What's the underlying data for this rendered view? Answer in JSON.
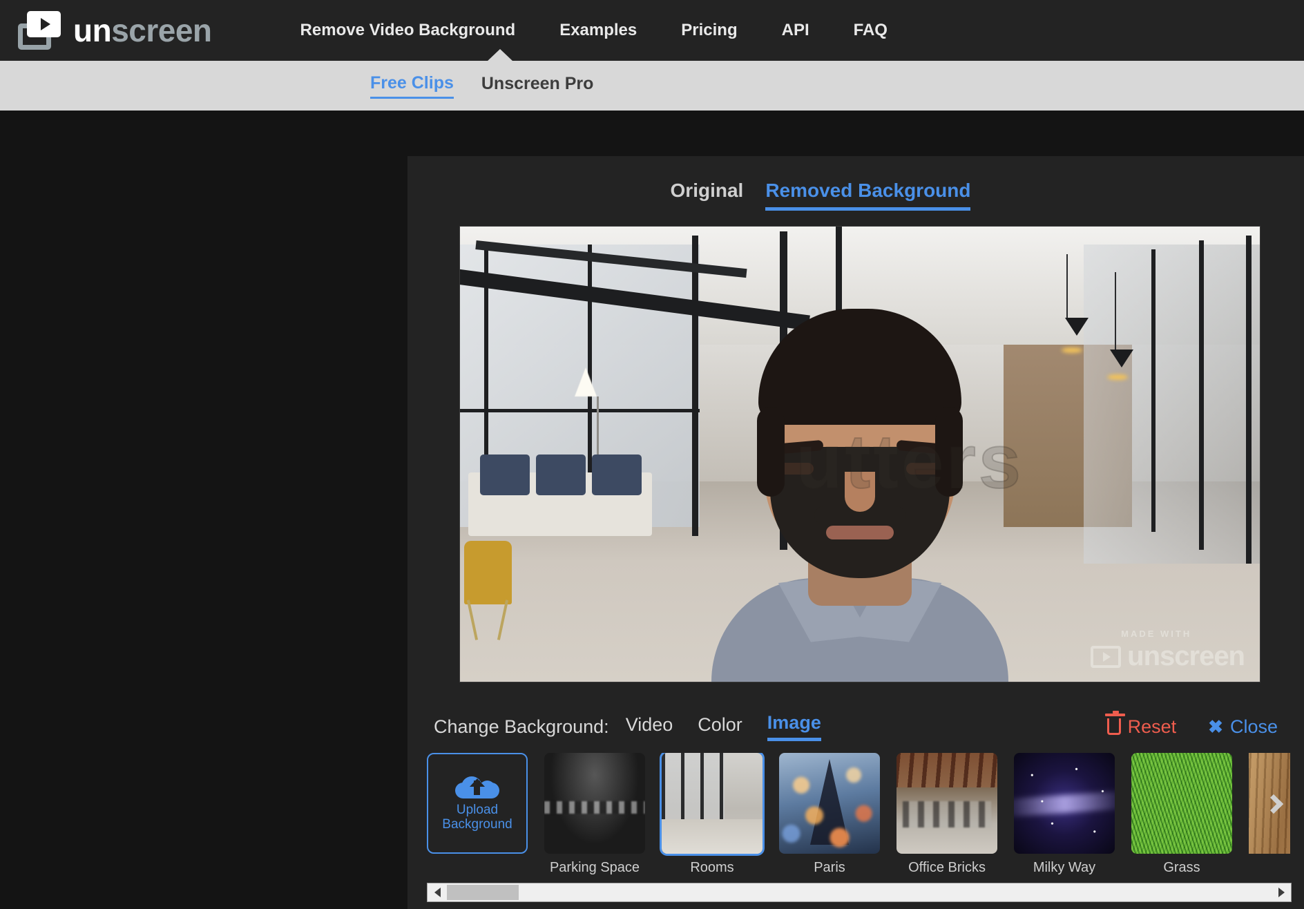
{
  "brand": {
    "name_prefix": "un",
    "name_suffix": "screen",
    "logo_icon": "video-play-stack-icon"
  },
  "topnav": {
    "links": [
      {
        "label": "Remove Video Background"
      },
      {
        "label": "Examples"
      },
      {
        "label": "Pricing"
      },
      {
        "label": "API"
      },
      {
        "label": "FAQ"
      }
    ]
  },
  "subnav": {
    "items": [
      {
        "label": "Free Clips",
        "active": true
      },
      {
        "label": "Unscreen Pro",
        "active": false
      }
    ]
  },
  "preview": {
    "tabs": [
      {
        "label": "Original",
        "active": false
      },
      {
        "label": "Removed Background",
        "active": true
      }
    ],
    "watermark_center": "utters",
    "watermark_corner_label": "MADE WITH",
    "watermark_corner_word": "unscreen"
  },
  "change_background": {
    "label": "Change Background:",
    "options": [
      {
        "label": "Video",
        "active": false
      },
      {
        "label": "Color",
        "active": false
      },
      {
        "label": "Image",
        "active": true
      }
    ],
    "reset_label": "Reset",
    "reset_icon": "trash-icon",
    "reset_color": "#ef5d4e",
    "close_label": "Close",
    "close_icon": "close-x-icon",
    "close_color": "#4a90e8"
  },
  "upload_tile": {
    "line1": "Upload",
    "line2": "Background",
    "icon": "cloud-upload-icon"
  },
  "thumbnails": [
    {
      "label": "Parking Space",
      "selected": false,
      "art": "tn-parking"
    },
    {
      "label": "Rooms",
      "selected": true,
      "art": "tn-rooms"
    },
    {
      "label": "Paris",
      "selected": false,
      "art": "tn-paris"
    },
    {
      "label": "Office Bricks",
      "selected": false,
      "art": "tn-bricks"
    },
    {
      "label": "Milky Way",
      "selected": false,
      "art": "tn-milky"
    },
    {
      "label": "Grass",
      "selected": false,
      "art": "tn-grass"
    },
    {
      "label": "",
      "selected": false,
      "art": "tn-wood"
    }
  ],
  "scrollbar": {
    "left_icon": "arrow-left-icon",
    "right_icon": "arrow-right-icon"
  },
  "next_arrow_icon": "chevron-right-icon",
  "colors": {
    "accent": "#4a90e8",
    "danger": "#ef5d4e",
    "nav_bg": "#232323",
    "page_bg": "#141414",
    "subnav_bg": "#d8d8d8"
  }
}
